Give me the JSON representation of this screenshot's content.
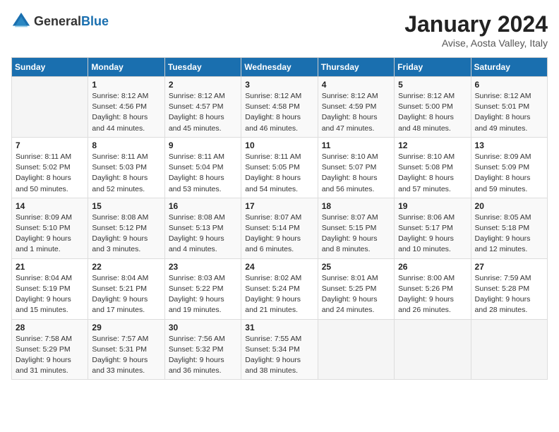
{
  "header": {
    "logo_general": "General",
    "logo_blue": "Blue",
    "title": "January 2024",
    "location": "Avise, Aosta Valley, Italy"
  },
  "weekdays": [
    "Sunday",
    "Monday",
    "Tuesday",
    "Wednesday",
    "Thursday",
    "Friday",
    "Saturday"
  ],
  "weeks": [
    [
      {
        "day": "",
        "sunrise": "",
        "sunset": "",
        "daylight": ""
      },
      {
        "day": "1",
        "sunrise": "Sunrise: 8:12 AM",
        "sunset": "Sunset: 4:56 PM",
        "daylight": "Daylight: 8 hours and 44 minutes."
      },
      {
        "day": "2",
        "sunrise": "Sunrise: 8:12 AM",
        "sunset": "Sunset: 4:57 PM",
        "daylight": "Daylight: 8 hours and 45 minutes."
      },
      {
        "day": "3",
        "sunrise": "Sunrise: 8:12 AM",
        "sunset": "Sunset: 4:58 PM",
        "daylight": "Daylight: 8 hours and 46 minutes."
      },
      {
        "day": "4",
        "sunrise": "Sunrise: 8:12 AM",
        "sunset": "Sunset: 4:59 PM",
        "daylight": "Daylight: 8 hours and 47 minutes."
      },
      {
        "day": "5",
        "sunrise": "Sunrise: 8:12 AM",
        "sunset": "Sunset: 5:00 PM",
        "daylight": "Daylight: 8 hours and 48 minutes."
      },
      {
        "day": "6",
        "sunrise": "Sunrise: 8:12 AM",
        "sunset": "Sunset: 5:01 PM",
        "daylight": "Daylight: 8 hours and 49 minutes."
      }
    ],
    [
      {
        "day": "7",
        "sunrise": "Sunrise: 8:11 AM",
        "sunset": "Sunset: 5:02 PM",
        "daylight": "Daylight: 8 hours and 50 minutes."
      },
      {
        "day": "8",
        "sunrise": "Sunrise: 8:11 AM",
        "sunset": "Sunset: 5:03 PM",
        "daylight": "Daylight: 8 hours and 52 minutes."
      },
      {
        "day": "9",
        "sunrise": "Sunrise: 8:11 AM",
        "sunset": "Sunset: 5:04 PM",
        "daylight": "Daylight: 8 hours and 53 minutes."
      },
      {
        "day": "10",
        "sunrise": "Sunrise: 8:11 AM",
        "sunset": "Sunset: 5:05 PM",
        "daylight": "Daylight: 8 hours and 54 minutes."
      },
      {
        "day": "11",
        "sunrise": "Sunrise: 8:10 AM",
        "sunset": "Sunset: 5:07 PM",
        "daylight": "Daylight: 8 hours and 56 minutes."
      },
      {
        "day": "12",
        "sunrise": "Sunrise: 8:10 AM",
        "sunset": "Sunset: 5:08 PM",
        "daylight": "Daylight: 8 hours and 57 minutes."
      },
      {
        "day": "13",
        "sunrise": "Sunrise: 8:09 AM",
        "sunset": "Sunset: 5:09 PM",
        "daylight": "Daylight: 8 hours and 59 minutes."
      }
    ],
    [
      {
        "day": "14",
        "sunrise": "Sunrise: 8:09 AM",
        "sunset": "Sunset: 5:10 PM",
        "daylight": "Daylight: 9 hours and 1 minute."
      },
      {
        "day": "15",
        "sunrise": "Sunrise: 8:08 AM",
        "sunset": "Sunset: 5:12 PM",
        "daylight": "Daylight: 9 hours and 3 minutes."
      },
      {
        "day": "16",
        "sunrise": "Sunrise: 8:08 AM",
        "sunset": "Sunset: 5:13 PM",
        "daylight": "Daylight: 9 hours and 4 minutes."
      },
      {
        "day": "17",
        "sunrise": "Sunrise: 8:07 AM",
        "sunset": "Sunset: 5:14 PM",
        "daylight": "Daylight: 9 hours and 6 minutes."
      },
      {
        "day": "18",
        "sunrise": "Sunrise: 8:07 AM",
        "sunset": "Sunset: 5:15 PM",
        "daylight": "Daylight: 9 hours and 8 minutes."
      },
      {
        "day": "19",
        "sunrise": "Sunrise: 8:06 AM",
        "sunset": "Sunset: 5:17 PM",
        "daylight": "Daylight: 9 hours and 10 minutes."
      },
      {
        "day": "20",
        "sunrise": "Sunrise: 8:05 AM",
        "sunset": "Sunset: 5:18 PM",
        "daylight": "Daylight: 9 hours and 12 minutes."
      }
    ],
    [
      {
        "day": "21",
        "sunrise": "Sunrise: 8:04 AM",
        "sunset": "Sunset: 5:19 PM",
        "daylight": "Daylight: 9 hours and 15 minutes."
      },
      {
        "day": "22",
        "sunrise": "Sunrise: 8:04 AM",
        "sunset": "Sunset: 5:21 PM",
        "daylight": "Daylight: 9 hours and 17 minutes."
      },
      {
        "day": "23",
        "sunrise": "Sunrise: 8:03 AM",
        "sunset": "Sunset: 5:22 PM",
        "daylight": "Daylight: 9 hours and 19 minutes."
      },
      {
        "day": "24",
        "sunrise": "Sunrise: 8:02 AM",
        "sunset": "Sunset: 5:24 PM",
        "daylight": "Daylight: 9 hours and 21 minutes."
      },
      {
        "day": "25",
        "sunrise": "Sunrise: 8:01 AM",
        "sunset": "Sunset: 5:25 PM",
        "daylight": "Daylight: 9 hours and 24 minutes."
      },
      {
        "day": "26",
        "sunrise": "Sunrise: 8:00 AM",
        "sunset": "Sunset: 5:26 PM",
        "daylight": "Daylight: 9 hours and 26 minutes."
      },
      {
        "day": "27",
        "sunrise": "Sunrise: 7:59 AM",
        "sunset": "Sunset: 5:28 PM",
        "daylight": "Daylight: 9 hours and 28 minutes."
      }
    ],
    [
      {
        "day": "28",
        "sunrise": "Sunrise: 7:58 AM",
        "sunset": "Sunset: 5:29 PM",
        "daylight": "Daylight: 9 hours and 31 minutes."
      },
      {
        "day": "29",
        "sunrise": "Sunrise: 7:57 AM",
        "sunset": "Sunset: 5:31 PM",
        "daylight": "Daylight: 9 hours and 33 minutes."
      },
      {
        "day": "30",
        "sunrise": "Sunrise: 7:56 AM",
        "sunset": "Sunset: 5:32 PM",
        "daylight": "Daylight: 9 hours and 36 minutes."
      },
      {
        "day": "31",
        "sunrise": "Sunrise: 7:55 AM",
        "sunset": "Sunset: 5:34 PM",
        "daylight": "Daylight: 9 hours and 38 minutes."
      },
      {
        "day": "",
        "sunrise": "",
        "sunset": "",
        "daylight": ""
      },
      {
        "day": "",
        "sunrise": "",
        "sunset": "",
        "daylight": ""
      },
      {
        "day": "",
        "sunrise": "",
        "sunset": "",
        "daylight": ""
      }
    ]
  ]
}
